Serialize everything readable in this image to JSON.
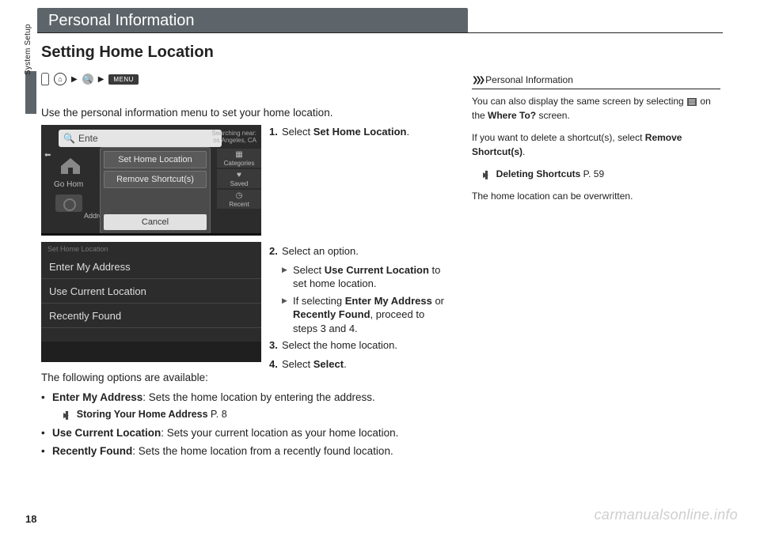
{
  "header": "Personal Information",
  "side_tab": "System Setup",
  "title": "Setting Home Location",
  "keypath": {
    "menu_badge": "MENU"
  },
  "intro": "Use the personal information menu to set your home location.",
  "screenshot1": {
    "search_prefix": "Ente",
    "searching": "Searching near:",
    "searching_sub": "os Angeles, CA",
    "dialog": {
      "opt1": "Set Home Location",
      "opt2": "Remove Shortcut(s)",
      "cancel": "Cancel"
    },
    "go_home": "Go Hom",
    "address": "Addres",
    "side": {
      "categories": "Categories",
      "saved": "Saved",
      "recent": "Recent"
    }
  },
  "screenshot2": {
    "title": "Set Home Location",
    "row1": "Enter My Address",
    "row2": "Use Current Location",
    "row3": "Recently Found"
  },
  "steps": {
    "s1_num": "1.",
    "s1a": "Select ",
    "s1b": "Set Home Location",
    "s1c": ".",
    "s2_num": "2.",
    "s2": "Select an option.",
    "s2_sub1a": "Select ",
    "s2_sub1b": "Use Current Location",
    "s2_sub1c": " to set home location.",
    "s2_sub2a": "If selecting ",
    "s2_sub2b": "Enter My Address",
    "s2_sub2c": " or ",
    "s2_sub2d": "Recently Found",
    "s2_sub2e": ", proceed to steps 3 and 4.",
    "s3_num": "3.",
    "s3": "Select the home location.",
    "s4_num": "4.",
    "s4a": "Select ",
    "s4b": "Select",
    "s4c": "."
  },
  "options_intro": "The following options are available:",
  "bullets": {
    "b1a": "Enter My Address",
    "b1b": ": Sets the home location by entering the address.",
    "b1_refa": "Storing Your Home Address",
    "b1_refb": " P. 8",
    "b2a": "Use Current Location",
    "b2b": ": Sets your current location as your home location.",
    "b3a": "Recently Found",
    "b3b": ": Sets the home location from a recently found location."
  },
  "info": {
    "header": "Personal Information",
    "p1a": "You can also display the same screen by selecting ",
    "p1b": " on the ",
    "p1c": "Where To?",
    "p1d": " screen.",
    "p2a": "If you want to delete a shortcut(s), select ",
    "p2b": "Remove Shortcut(s)",
    "p2c": ".",
    "refa": "Deleting Shortcuts",
    "refb": " P. 59",
    "p3": "The home location can be overwritten."
  },
  "page_number": "18",
  "watermark": "carmanualsonline.info"
}
